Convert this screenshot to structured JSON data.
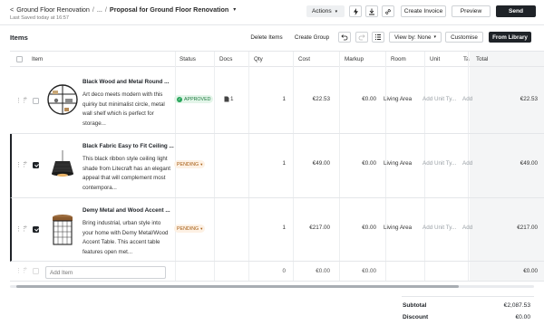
{
  "breadcrumb": {
    "back_glyph": "<",
    "project": "Ground Floor Renovation",
    "sep1": "/",
    "ellipsis": "...",
    "sep2": "/",
    "current": "Proposal for Ground Floor Renovation",
    "caret": "▾"
  },
  "saved_text": "Last Saved today at 16:57",
  "toolbar": {
    "actions_label": "Actions",
    "create_invoice_label": "Create Invoice",
    "preview_label": "Preview",
    "send_label": "Send"
  },
  "items_section": {
    "title": "Items",
    "delete_items_label": "Delete Items",
    "create_group_label": "Create Group",
    "view_by_label": "View by: None",
    "customise_label": "Customise",
    "from_library_label": "From Library"
  },
  "columns": [
    "Item",
    "Status",
    "Docs",
    "Qty",
    "Cost",
    "Markup",
    "Room",
    "Unit",
    "Ta",
    "Total"
  ],
  "rows": [
    {
      "name": "Black Wood and Metal Round ...",
      "description": "Art deco meets modern with this quirky but minimalist circle, metal wall shelf which is perfect for storage...",
      "status": "APPROVED",
      "docs": "1",
      "qty": "1",
      "cost": "€22.53",
      "markup": "€0.00",
      "room": "Living Area",
      "unit": "Add Unit Ty...",
      "tax": "Add",
      "total": "€22.53",
      "checked": false
    },
    {
      "name": "Black Fabric Easy to Fit Ceiling ...",
      "description": "This black ribbon style ceiling light shade from Litecraft has an elegant appeal that will complement most contempora...",
      "status": "PENDING",
      "docs": "",
      "qty": "1",
      "cost": "€49.00",
      "markup": "€0.00",
      "room": "Living Area",
      "unit": "Add Unit Ty...",
      "tax": "Add",
      "total": "€49.00",
      "checked": true
    },
    {
      "name": "Demy Metal and Wood Accent ...",
      "description": "Bring industrial, urban style into your home with Demy Metal/Wood Accent Table. This accent table features open met...",
      "status": "PENDING",
      "docs": "",
      "qty": "1",
      "cost": "€217.00",
      "markup": "€0.00",
      "room": "Living Area",
      "unit": "Add Unit Ty...",
      "tax": "Add",
      "total": "€217.00",
      "checked": true
    }
  ],
  "add_row": {
    "placeholder": "Add Item",
    "qty": "0",
    "cost": "€0.00",
    "markup": "€0.00",
    "total": "€0.00"
  },
  "summary": {
    "subtotal_label": "Subtotal",
    "subtotal_value": "€2,087.53",
    "discount_label": "Discount",
    "discount_value": "€0.00"
  },
  "colors": {
    "primary_dark": "#1f2328",
    "approved_green": "#27a55a",
    "pending_orange": "#a45a10"
  }
}
